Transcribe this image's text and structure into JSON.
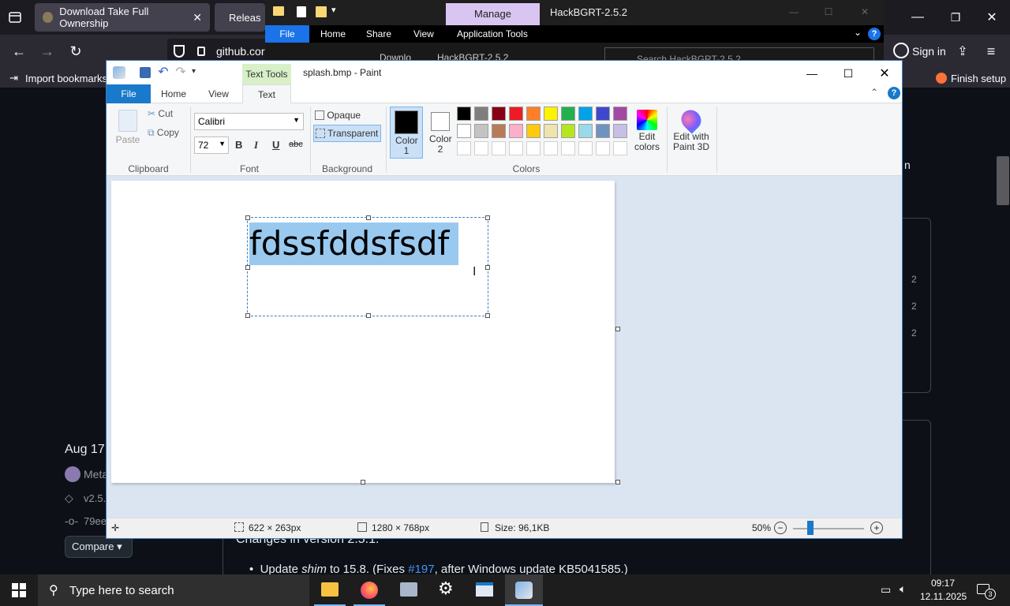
{
  "firefox": {
    "tab1": "Download Take Full Ownership",
    "tab2": "Releas",
    "url": "github.cor",
    "sign_in": "Sign in",
    "import_bookmarks": "Import bookmarks...",
    "finish_setup": "Finish setup"
  },
  "github": {
    "date": "Aug 17,",
    "author": "Meta",
    "tag": "v2.5.",
    "commit": "79ee",
    "compare": "Compare",
    "changes": "Changes in version 2.5.1:",
    "bullet_pre": "Update ",
    "bullet_em": "shim",
    "bullet_mid": " to 15.8. (Fixes ",
    "bullet_link": "#197",
    "bullet_post": ", after Windows update KB5041585.)",
    "right_fragment": "n",
    "right_numbers": [
      "2",
      "2",
      "2"
    ]
  },
  "explorer": {
    "manage": "Manage",
    "title": "HackBGRT-2.5.2",
    "tabs": [
      "File",
      "Home",
      "Share",
      "View",
      "Application Tools"
    ],
    "address": [
      "Downlo",
      "HackBGRT-2.5.2"
    ],
    "search_placeholder": "Search HackBGRT-2.5.2"
  },
  "paint": {
    "title": "splash.bmp - Paint",
    "contextual_group": "Text Tools",
    "tabs": {
      "file": "File",
      "home": "Home",
      "view": "View",
      "text": "Text"
    },
    "clipboard": {
      "paste": "Paste",
      "cut": "Cut",
      "copy": "Copy",
      "label": "Clipboard"
    },
    "font": {
      "family": "Calibri",
      "size": "72",
      "label": "Font",
      "bold": "B",
      "italic": "I",
      "underline": "U",
      "strike": "abc"
    },
    "background": {
      "opaque": "Opaque",
      "transparent": "Transparent",
      "label": "Background"
    },
    "colors": {
      "color1": "Color 1",
      "color2": "Color 2",
      "edit_colors": "Edit colors",
      "edit_3d": "Edit with Paint 3D",
      "label": "Colors",
      "color1_value": "#000000",
      "color2_value": "#ffffff",
      "row1": [
        "#000000",
        "#7f7f7f",
        "#880015",
        "#ed1c24",
        "#ff7f27",
        "#fff200",
        "#22b14c",
        "#00a2e8",
        "#3f48cc",
        "#a349a4"
      ],
      "row2": [
        "#ffffff",
        "#c3c3c3",
        "#b97a57",
        "#ffaec9",
        "#ffc90e",
        "#efe4b0",
        "#b5e61d",
        "#99d9ea",
        "#7092be",
        "#c8bfe7"
      ]
    },
    "canvas_text": "fdssfddsfsdf",
    "status": {
      "selection": "622 × 263px",
      "image_size": "1280 × 768px",
      "file_size": "Size: 96,1KB",
      "zoom": "50%"
    }
  },
  "taskbar": {
    "search": "Type here to search",
    "time": "09:17",
    "date": "12.11.2025",
    "notifications": "3"
  }
}
